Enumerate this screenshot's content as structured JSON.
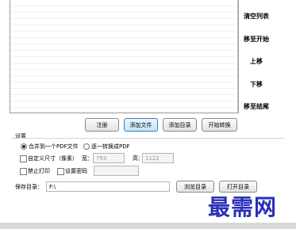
{
  "side_buttons": {
    "clear": "清空列表",
    "move_top": "移至开始",
    "move_up": "上移",
    "move_down": "下移",
    "move_bottom": "移至结尾"
  },
  "action_buttons": {
    "register": "注册",
    "add_file": "添加文件",
    "add_dir": "添加目录",
    "start": "开始转换"
  },
  "settings": {
    "group_label": "设置",
    "merge_option": "合并到一个PDF文件",
    "separate_option": "逐一转换成PDF",
    "custom_size_label": "自定义尺寸（像素）",
    "width_label": "宽：",
    "width_value": "793",
    "height_label": "高：",
    "height_value": "1122",
    "disable_print_label": "禁止打印",
    "set_password_label": "设置密码",
    "password_value": "",
    "save_dir_label": "保存目录：",
    "save_dir_value": "F:\\",
    "browse_button": "浏览目录",
    "open_button": "打开目录"
  },
  "watermark": "最需网"
}
